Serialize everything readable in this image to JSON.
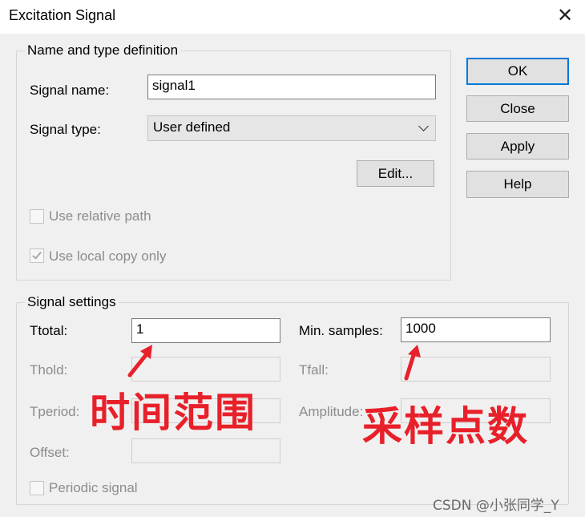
{
  "window": {
    "title": "Excitation Signal",
    "close_glyph": "✕"
  },
  "group_name_type": {
    "label": "Name and type definition",
    "signal_name_label": "Signal name:",
    "signal_name_value": "signal1",
    "signal_type_label": "Signal type:",
    "signal_type_value": "User defined",
    "edit_button": "Edit...",
    "use_relative_path": {
      "label": "Use relative path",
      "checked": false
    },
    "use_local_copy": {
      "label": "Use local copy only",
      "checked": true
    }
  },
  "buttons": {
    "ok": "OK",
    "close": "Close",
    "apply": "Apply",
    "help": "Help"
  },
  "group_signal_settings": {
    "label": "Signal settings",
    "ttotal_label": "Ttotal:",
    "ttotal_value": "1",
    "min_samples_label": "Min. samples:",
    "min_samples_value": "1000",
    "thold_label": "Thold:",
    "tfall_label": "Tfall:",
    "tperiod_label": "Tperiod:",
    "amplitude_label": "Amplitude:",
    "offset_label": "Offset:",
    "periodic_signal": {
      "label": "Periodic signal",
      "checked": false
    }
  },
  "annotations": {
    "time_range": "时间范围",
    "sample_points": "采样点数"
  },
  "watermark": "CSDN @小张同学_Y",
  "colors": {
    "accent": "#0078d7",
    "annotation": "#e8202a",
    "dialog_bg": "#f0f0f0"
  }
}
